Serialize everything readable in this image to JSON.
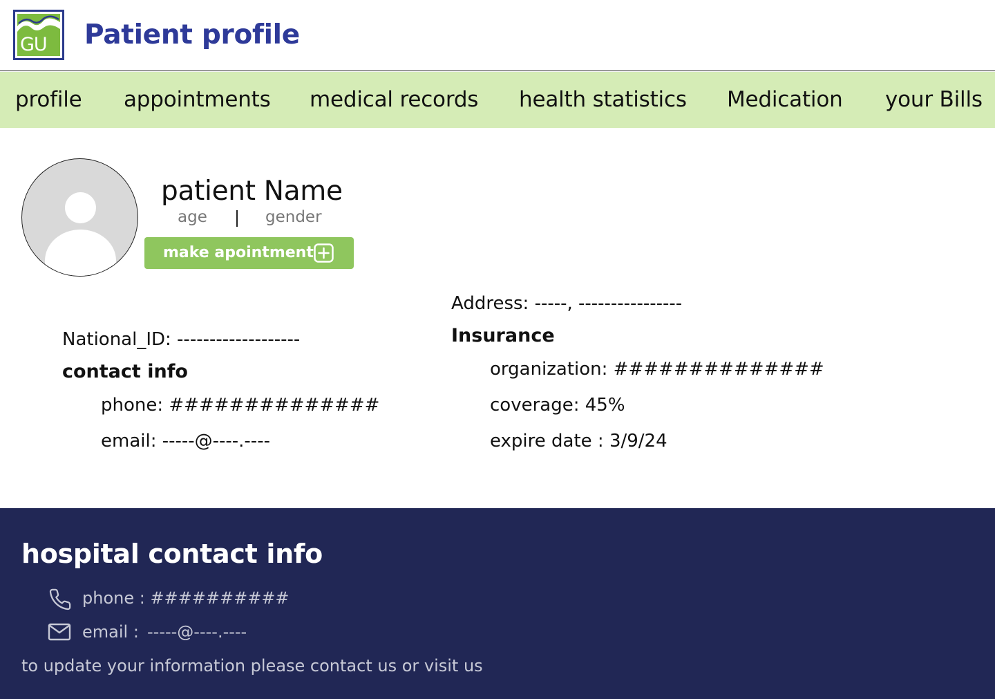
{
  "header": {
    "logo_text": "GU",
    "title": "Patient profile"
  },
  "nav": {
    "items": [
      {
        "label": "profile"
      },
      {
        "label": "appointments"
      },
      {
        "label": "medical records"
      },
      {
        "label": "health statistics"
      },
      {
        "label": "Medication"
      },
      {
        "label": "your Bills"
      }
    ]
  },
  "profile": {
    "avatar_icon": "user-avatar-icon",
    "name": "patient Name",
    "age_label": "age",
    "gender_label": "gender",
    "appointment_button": "make apointment",
    "appointment_icon": "plus-square-icon"
  },
  "details": {
    "national_id": "National_ID: -------------------",
    "contact_heading": "contact info",
    "phone": "phone: ##############",
    "email": "email: -----@----.----",
    "address": "Address: -----, ----------------",
    "insurance_heading": "Insurance",
    "organization": "organization: ##############",
    "coverage": "coverage: 45%",
    "expire": "expire date : 3/9/24"
  },
  "footer": {
    "title": "hospital contact info",
    "phone_icon": "phone-icon",
    "phone": "phone : ##########",
    "email_icon": "mail-icon",
    "email_label": "email :",
    "email_value": "-----@----.----",
    "note": "to update your information please contact us or visit us"
  },
  "colors": {
    "title_blue": "#2e3a99",
    "nav_bg": "#d5ecb6",
    "button_green": "#8fc65e",
    "footer_bg": "#212755"
  }
}
